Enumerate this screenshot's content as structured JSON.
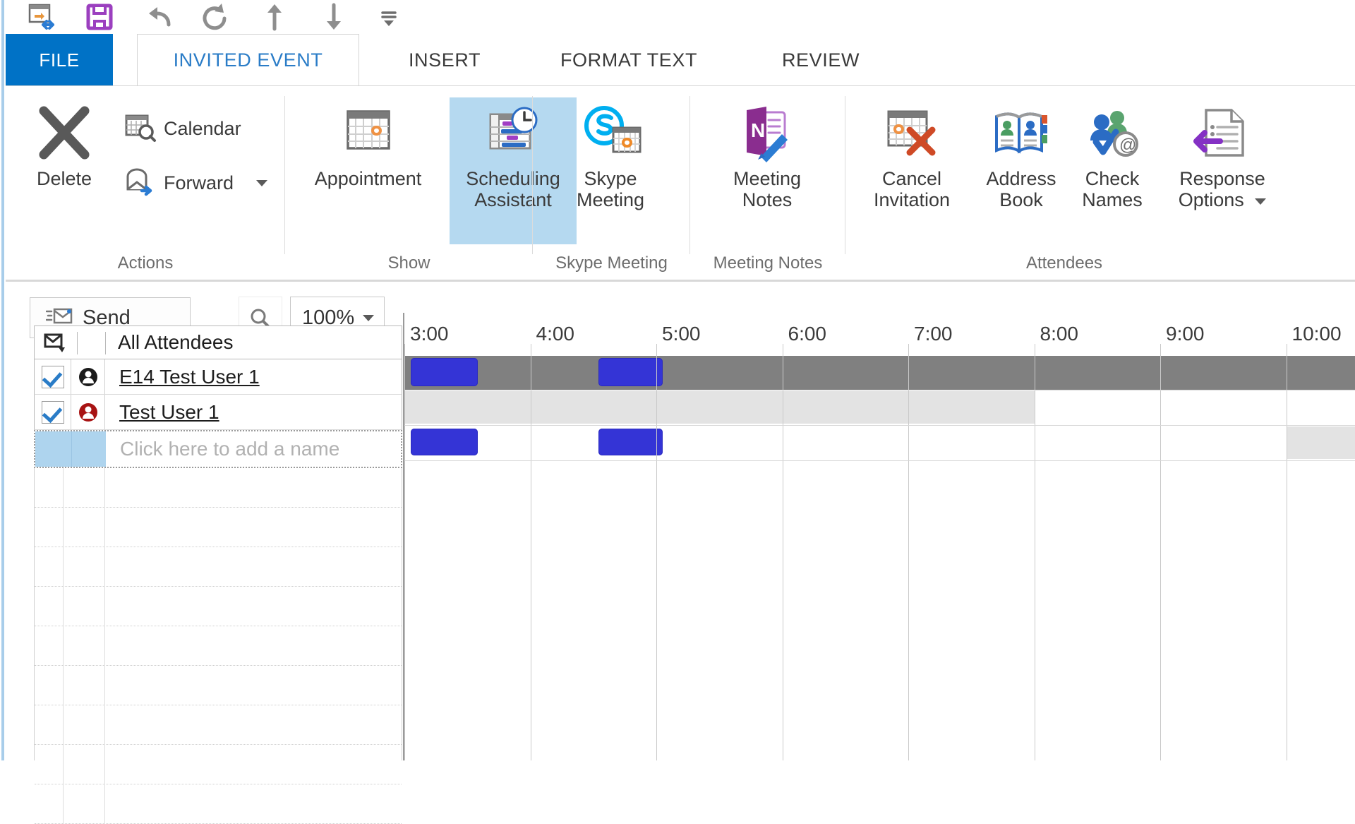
{
  "quick_access": {
    "items": [
      {
        "name": "move-to-folder-icon",
        "label": "Move to Folder"
      },
      {
        "name": "save-icon",
        "label": "Save"
      },
      {
        "name": "undo-icon",
        "label": "Undo"
      },
      {
        "name": "redo-icon",
        "label": "Redo"
      },
      {
        "name": "previous-item-icon",
        "label": "Previous Item"
      },
      {
        "name": "next-item-icon",
        "label": "Next Item"
      },
      {
        "name": "customize-quick-access-toolbar-icon",
        "label": "Customize Quick Access Toolbar"
      }
    ]
  },
  "tabs": [
    {
      "id": "file",
      "label": "FILE"
    },
    {
      "id": "invited-event",
      "label": "INVITED EVENT"
    },
    {
      "id": "insert",
      "label": "INSERT"
    },
    {
      "id": "format-text",
      "label": "FORMAT TEXT"
    },
    {
      "id": "review",
      "label": "REVIEW"
    }
  ],
  "active_tab": "INVITED EVENT",
  "ribbon": {
    "groups": [
      {
        "id": "actions",
        "label": "Actions",
        "buttons": [
          {
            "id": "delete",
            "label": "Delete",
            "icon": "delete-x-icon"
          },
          {
            "id": "calendar",
            "label": "Calendar",
            "icon": "calendar-search-icon"
          },
          {
            "id": "forward",
            "label": "Forward",
            "icon": "forward-envelope-icon",
            "has_caret": true
          }
        ]
      },
      {
        "id": "show",
        "label": "Show",
        "buttons": [
          {
            "id": "appointment",
            "label": "Appointment",
            "icon": "calendar-icon",
            "selected": false
          },
          {
            "id": "scheduling-assistant",
            "label": "Scheduling\nAssistant",
            "line1": "Scheduling",
            "line2": "Assistant",
            "icon": "scheduling-assistant-icon",
            "selected": true
          }
        ]
      },
      {
        "id": "skype-meeting",
        "label": "Skype Meeting",
        "buttons": [
          {
            "id": "skype-meeting",
            "line1": "Skype",
            "line2": "Meeting",
            "icon": "skype-meeting-icon"
          }
        ]
      },
      {
        "id": "meeting-notes",
        "label": "Meeting Notes",
        "buttons": [
          {
            "id": "meeting-notes",
            "line1": "Meeting",
            "line2": "Notes",
            "icon": "onenote-icon"
          }
        ]
      },
      {
        "id": "attendees",
        "label": "Attendees",
        "buttons": [
          {
            "id": "cancel-invitation",
            "line1": "Cancel",
            "line2": "Invitation",
            "icon": "cancel-invitation-icon"
          },
          {
            "id": "address-book",
            "line1": "Address",
            "line2": "Book",
            "icon": "address-book-icon"
          },
          {
            "id": "check-names",
            "line1": "Check",
            "line2": "Names",
            "icon": "check-names-icon"
          },
          {
            "id": "response-options",
            "line1": "Response",
            "line2": "Options",
            "icon": "response-options-icon",
            "has_caret": true
          }
        ]
      }
    ]
  },
  "toolbar": {
    "send_label": "Send",
    "zoom_value": "100%",
    "zoom_icon": "magnifier-icon"
  },
  "attendees_panel": {
    "header_icon": "sort-attendees-icon",
    "header_label": "All Attendees",
    "rows": [
      {
        "id": "e14-test-user-1",
        "name": "E14 Test User  1",
        "checked": true,
        "role_icon": "organizer-icon",
        "role_color": "#1a1a1a"
      },
      {
        "id": "test-user-1",
        "name": "Test User  1",
        "checked": true,
        "role_icon": "required-attendee-icon",
        "role_color": "#a81313"
      }
    ],
    "add_row_placeholder": "Click here to add a name",
    "empty_row_count": 9
  },
  "schedule": {
    "time_labels": [
      "3:00",
      "4:00",
      "5:00",
      "6:00",
      "7:00",
      "8:00",
      "9:00",
      "10:00"
    ],
    "hours_visible": 8,
    "colors": {
      "busy": "#3434d6",
      "all_attendees_band": "#808080",
      "free_band": "#e3e3e3",
      "selected_tab": "#b5d9f0",
      "file_tab": "#0072c6"
    },
    "rows": [
      {
        "id": "all-attendees",
        "kind": "summary",
        "band": {
          "start_hour": 3.0,
          "end_hour": 11.0
        },
        "busy_blocks": [
          {
            "start_hour": 3.05,
            "end_hour": 3.58
          },
          {
            "start_hour": 4.54,
            "end_hour": 5.05
          }
        ]
      },
      {
        "id": "e14-test-user-1",
        "kind": "attendee",
        "free_band": {
          "start_hour": 3.0,
          "end_hour": 8.0
        },
        "busy_blocks": []
      },
      {
        "id": "test-user-1",
        "kind": "attendee",
        "free_band": {
          "start_hour": 10.0,
          "end_hour": 11.0
        },
        "busy_blocks": [
          {
            "start_hour": 3.05,
            "end_hour": 3.58
          },
          {
            "start_hour": 4.54,
            "end_hour": 5.05
          }
        ]
      }
    ]
  }
}
